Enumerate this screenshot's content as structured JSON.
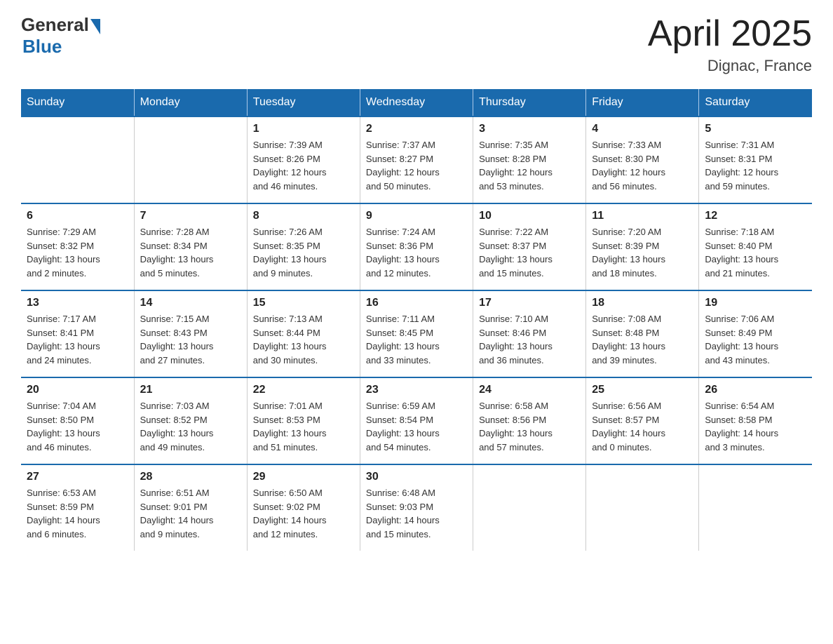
{
  "header": {
    "logo_general": "General",
    "logo_blue": "Blue",
    "title": "April 2025",
    "location": "Dignac, France"
  },
  "weekdays": [
    "Sunday",
    "Monday",
    "Tuesday",
    "Wednesday",
    "Thursday",
    "Friday",
    "Saturday"
  ],
  "weeks": [
    [
      {
        "day": "",
        "info": ""
      },
      {
        "day": "",
        "info": ""
      },
      {
        "day": "1",
        "info": "Sunrise: 7:39 AM\nSunset: 8:26 PM\nDaylight: 12 hours\nand 46 minutes."
      },
      {
        "day": "2",
        "info": "Sunrise: 7:37 AM\nSunset: 8:27 PM\nDaylight: 12 hours\nand 50 minutes."
      },
      {
        "day": "3",
        "info": "Sunrise: 7:35 AM\nSunset: 8:28 PM\nDaylight: 12 hours\nand 53 minutes."
      },
      {
        "day": "4",
        "info": "Sunrise: 7:33 AM\nSunset: 8:30 PM\nDaylight: 12 hours\nand 56 minutes."
      },
      {
        "day": "5",
        "info": "Sunrise: 7:31 AM\nSunset: 8:31 PM\nDaylight: 12 hours\nand 59 minutes."
      }
    ],
    [
      {
        "day": "6",
        "info": "Sunrise: 7:29 AM\nSunset: 8:32 PM\nDaylight: 13 hours\nand 2 minutes."
      },
      {
        "day": "7",
        "info": "Sunrise: 7:28 AM\nSunset: 8:34 PM\nDaylight: 13 hours\nand 5 minutes."
      },
      {
        "day": "8",
        "info": "Sunrise: 7:26 AM\nSunset: 8:35 PM\nDaylight: 13 hours\nand 9 minutes."
      },
      {
        "day": "9",
        "info": "Sunrise: 7:24 AM\nSunset: 8:36 PM\nDaylight: 13 hours\nand 12 minutes."
      },
      {
        "day": "10",
        "info": "Sunrise: 7:22 AM\nSunset: 8:37 PM\nDaylight: 13 hours\nand 15 minutes."
      },
      {
        "day": "11",
        "info": "Sunrise: 7:20 AM\nSunset: 8:39 PM\nDaylight: 13 hours\nand 18 minutes."
      },
      {
        "day": "12",
        "info": "Sunrise: 7:18 AM\nSunset: 8:40 PM\nDaylight: 13 hours\nand 21 minutes."
      }
    ],
    [
      {
        "day": "13",
        "info": "Sunrise: 7:17 AM\nSunset: 8:41 PM\nDaylight: 13 hours\nand 24 minutes."
      },
      {
        "day": "14",
        "info": "Sunrise: 7:15 AM\nSunset: 8:43 PM\nDaylight: 13 hours\nand 27 minutes."
      },
      {
        "day": "15",
        "info": "Sunrise: 7:13 AM\nSunset: 8:44 PM\nDaylight: 13 hours\nand 30 minutes."
      },
      {
        "day": "16",
        "info": "Sunrise: 7:11 AM\nSunset: 8:45 PM\nDaylight: 13 hours\nand 33 minutes."
      },
      {
        "day": "17",
        "info": "Sunrise: 7:10 AM\nSunset: 8:46 PM\nDaylight: 13 hours\nand 36 minutes."
      },
      {
        "day": "18",
        "info": "Sunrise: 7:08 AM\nSunset: 8:48 PM\nDaylight: 13 hours\nand 39 minutes."
      },
      {
        "day": "19",
        "info": "Sunrise: 7:06 AM\nSunset: 8:49 PM\nDaylight: 13 hours\nand 43 minutes."
      }
    ],
    [
      {
        "day": "20",
        "info": "Sunrise: 7:04 AM\nSunset: 8:50 PM\nDaylight: 13 hours\nand 46 minutes."
      },
      {
        "day": "21",
        "info": "Sunrise: 7:03 AM\nSunset: 8:52 PM\nDaylight: 13 hours\nand 49 minutes."
      },
      {
        "day": "22",
        "info": "Sunrise: 7:01 AM\nSunset: 8:53 PM\nDaylight: 13 hours\nand 51 minutes."
      },
      {
        "day": "23",
        "info": "Sunrise: 6:59 AM\nSunset: 8:54 PM\nDaylight: 13 hours\nand 54 minutes."
      },
      {
        "day": "24",
        "info": "Sunrise: 6:58 AM\nSunset: 8:56 PM\nDaylight: 13 hours\nand 57 minutes."
      },
      {
        "day": "25",
        "info": "Sunrise: 6:56 AM\nSunset: 8:57 PM\nDaylight: 14 hours\nand 0 minutes."
      },
      {
        "day": "26",
        "info": "Sunrise: 6:54 AM\nSunset: 8:58 PM\nDaylight: 14 hours\nand 3 minutes."
      }
    ],
    [
      {
        "day": "27",
        "info": "Sunrise: 6:53 AM\nSunset: 8:59 PM\nDaylight: 14 hours\nand 6 minutes."
      },
      {
        "day": "28",
        "info": "Sunrise: 6:51 AM\nSunset: 9:01 PM\nDaylight: 14 hours\nand 9 minutes."
      },
      {
        "day": "29",
        "info": "Sunrise: 6:50 AM\nSunset: 9:02 PM\nDaylight: 14 hours\nand 12 minutes."
      },
      {
        "day": "30",
        "info": "Sunrise: 6:48 AM\nSunset: 9:03 PM\nDaylight: 14 hours\nand 15 minutes."
      },
      {
        "day": "",
        "info": ""
      },
      {
        "day": "",
        "info": ""
      },
      {
        "day": "",
        "info": ""
      }
    ]
  ]
}
